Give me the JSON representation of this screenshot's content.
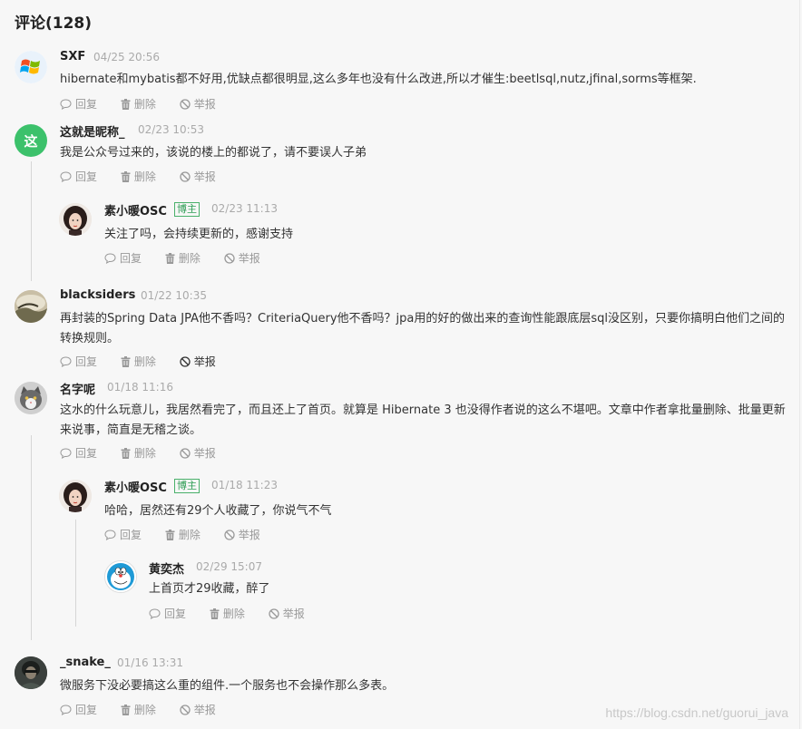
{
  "header": {
    "title": "评论(128)"
  },
  "actions": {
    "reply": "回复",
    "delete": "删除",
    "report": "举报"
  },
  "comments": [
    {
      "user": "SXF",
      "time": "04/25 20:56",
      "text": "hibernate和mybatis都不好用,优缺点都很明显,这么多年也没有什么改进,所以才催生:beetlsql,nutz,jfinal,sorms等框架."
    },
    {
      "user": "这就是昵称_",
      "avatar_char": "这",
      "time": "02/23 10:53",
      "text": "我是公众号过来的，该说的楼上的都说了，请不要误人子弟"
    },
    {
      "user": "素小暖OSC",
      "badge": "博主",
      "time": "02/23 11:13",
      "text": "关注了吗，会持续更新的，感谢支持"
    },
    {
      "user": "blacksiders",
      "time": "01/22 10:35",
      "text": "再封装的Spring Data JPA他不香吗？CriteriaQuery他不香吗？jpa用的好的做出来的查询性能跟底层sql没区别，只要你搞明白他们之间的转换规则。"
    },
    {
      "user": "名字呢",
      "time": "01/18 11:16",
      "text": "这水的什么玩意儿，我居然看完了，而且还上了首页。就算是 Hibernate 3 也没得作者说的这么不堪吧。文章中作者拿批量删除、批量更新来说事，简直是无稽之谈。"
    },
    {
      "user": "素小暖OSC",
      "badge": "博主",
      "time": "01/18 11:23",
      "text": "哈哈，居然还有29个人收藏了，你说气不气"
    },
    {
      "user": "黄奕杰",
      "time": "02/29 15:07",
      "text": "上首页才29收藏，醉了"
    },
    {
      "user": "_snake_",
      "time": "01/16 13:31",
      "text": "微服务下没必要搞这么重的组件.一个服务也不会操作那么多表。"
    }
  ],
  "watermark": "https://blog.csdn.net/guorui_java",
  "colors": {
    "badge_green": "#49b06a",
    "avatar_green": "#3cc16b",
    "muted": "#999999"
  }
}
